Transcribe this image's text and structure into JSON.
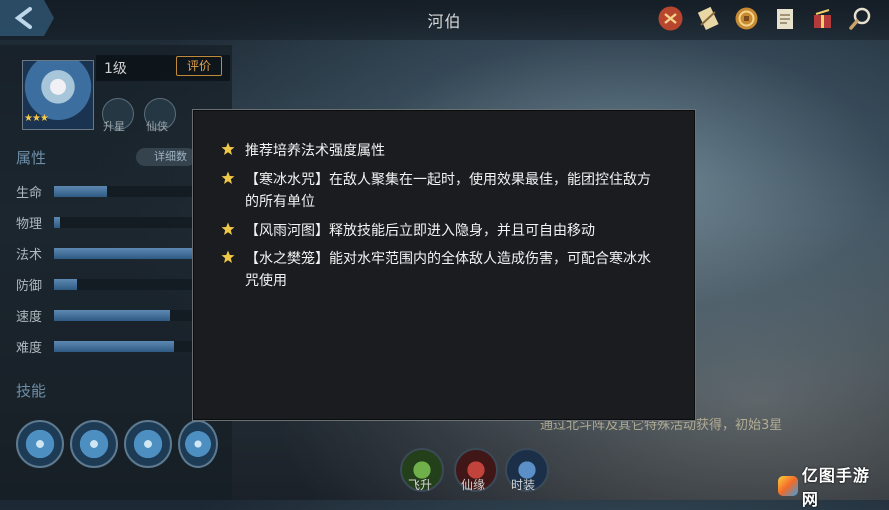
{
  "header": {
    "title": "河伯"
  },
  "hero": {
    "level": "1级",
    "rate_label": "评价",
    "stars": "★★★"
  },
  "attributes": {
    "title": "属性",
    "detail_label": "详细数",
    "items": [
      {
        "label": "生命",
        "fill": 0.35
      },
      {
        "label": "物理",
        "fill": 0.04
      },
      {
        "label": "法术",
        "fill": 1.0
      },
      {
        "label": "防御",
        "fill": 0.15
      },
      {
        "label": "速度",
        "fill": 0.77
      },
      {
        "label": "难度",
        "fill": 0.8
      }
    ]
  },
  "skills": {
    "title": "技能"
  },
  "mini_labels": [
    "升星",
    "仙侠"
  ],
  "tips": [
    "推荐培养法术强度属性",
    "【寒冰水咒】在敌人聚集在一起时，使用效果最佳，能团控住敌方的所有单位",
    "【风雨河图】释放技能后立即进入隐身，并且可自由移动",
    "【水之樊笼】能对水牢范围内的全体敌人造成伤害，可配合寒冰水咒使用"
  ],
  "bottom": {
    "note": "通过北斗阵及其它特殊活动获得，初始3星",
    "buttons": [
      "飞升",
      "仙缘",
      "时装"
    ]
  },
  "watermark": "亿图手游网",
  "colors": {
    "accent_gold": "#f4c94a",
    "rate_orange": "#e3a14e",
    "attr_fill": "#4a7aa6"
  }
}
